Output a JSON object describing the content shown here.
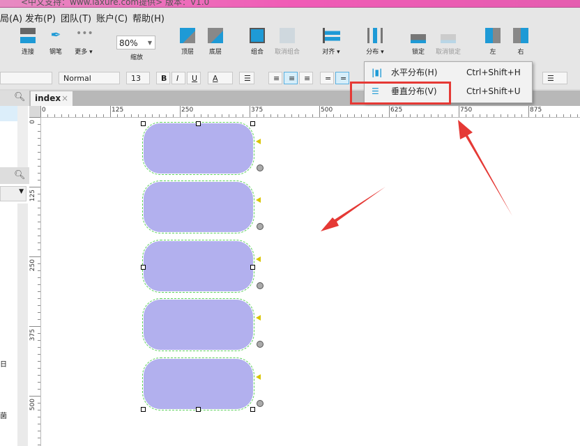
{
  "title_bar": {
    "text": "<中文支持：www.iaxure.com提供> 版本：V1.0"
  },
  "menu": [
    "局(A)",
    "发布(P)",
    "团队(T)",
    "账户(C)",
    "帮助(H)"
  ],
  "toolbar": {
    "items": [
      "连接",
      "钢笔",
      "更多 ▾",
      "缩放",
      "顶层",
      "底层",
      "组合",
      "取消组合",
      "对齐 ▾",
      "分布 ▾",
      "锁定",
      "取消锁定",
      "左",
      "右"
    ],
    "zoom_value": "80%"
  },
  "format": {
    "style": "Normal",
    "font_size": "13",
    "bold": "B",
    "italic": "I",
    "underline": "U",
    "font_color": "A"
  },
  "tab": {
    "label": "index",
    "close": "×"
  },
  "ruler": {
    "h": [
      "0",
      "125",
      "250",
      "375",
      "500",
      "625",
      "750",
      "875"
    ],
    "v": [
      "0",
      "125",
      "250",
      "375",
      "500"
    ]
  },
  "dropdown": {
    "items": [
      {
        "label": "水平分布(H)",
        "shortcut": "Ctrl+Shift+H"
      },
      {
        "label": "垂直分布(V)",
        "shortcut": "Ctrl+Shift+U"
      }
    ]
  },
  "left_panel": {
    "a": "日",
    "b": "菌"
  },
  "colors": {
    "shape_fill": "#b2b0ee",
    "accent": "#1e9ad6",
    "highlight": "#e53935"
  }
}
